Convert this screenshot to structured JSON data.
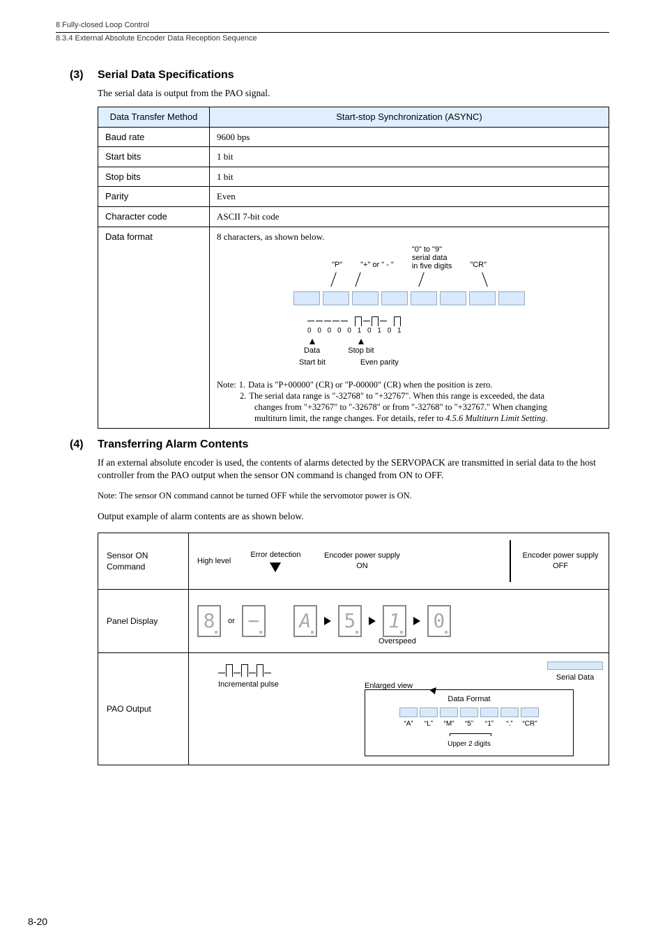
{
  "page": {
    "chapter_line": "8  Fully-closed Loop Control",
    "section_line": "8.3.4  External Absolute Encoder Data Reception Sequence",
    "page_number": "8-20"
  },
  "sec3": {
    "num": "(3)",
    "title": "Serial Data Specifications",
    "intro": "The serial data is output from the PAO signal.",
    "header_left": "Data Transfer Method",
    "header_right": "Start-stop Synchronization (ASYNC)",
    "rows": {
      "baud_label": "Baud rate",
      "baud_value": "9600 bps",
      "start_label": "Start bits",
      "start_value": "1 bit",
      "stop_label": "Stop bits",
      "stop_value": "1 bit",
      "parity_label": "Parity",
      "parity_value": "Even",
      "char_label": "Character code",
      "char_value": "ASCII 7-bit code",
      "format_label": "Data format",
      "format_value": "8 characters, as shown below."
    },
    "diagram": {
      "p_label": "\"P\"",
      "sign_label": "\"+\" or \" - \"",
      "digits_label_1": "\"0\" to \"9\"",
      "digits_label_2": "serial data",
      "digits_label_3": "in five digits",
      "cr_label": "\"CR\"",
      "bits_string": "0 0 0 0 0  1 0 1 0  1",
      "start_bit": "Start bit",
      "data_lbl": "Data",
      "even_parity": "Even parity",
      "stop_bit": "Stop bit"
    },
    "note_head": "Note:",
    "note_1_num": "1.",
    "note_1": "Data is \"P+00000\" (CR) or \"P-00000\" (CR) when the position is zero.",
    "note_2_num": "2.",
    "note_2a": "The serial data range is \"-32768\" to \"+32767\". When this range is exceeded, the data",
    "note_2b": "changes from \"+32767\" to \"-32678\" or from \"-32768\" to \"+32767.\"  When changing",
    "note_2c": "multiturn limit, the range changes.  For details, refer to ",
    "note_2c_ref": "4.5.6 Multiturn Limit Setting",
    "note_2c_end": "."
  },
  "sec4": {
    "num": "(4)",
    "title": "Transferring Alarm Contents",
    "para": "If an external absolute encoder is used, the contents of alarms detected by the SERVOPACK are transmitted in serial data to the host controller from the PAO output when the sensor ON command is changed from ON to OFF.",
    "note_head": "Note:",
    "note_text": "The sensor ON command cannot be turned OFF while the servomotor power is ON.",
    "out_line": "Output example of alarm contents are as shown below.",
    "row_sensor": "Sensor ON Command",
    "row_panel": "Panel Display",
    "row_pao": "PAO Output",
    "high_level": "High level",
    "error_det": "Error detection",
    "enc_on": "Encoder power supply ON",
    "enc_off": "Encoder power supply OFF",
    "or_text": "or",
    "overspeed": "Overspeed",
    "inc_pulse": "Incremental pulse",
    "serial_data": "Serial Data",
    "enlarged_view": "Enlarged view",
    "data_format": "Data Format",
    "df_chars": [
      "“A”",
      "“L”",
      "“M”",
      "“5”",
      "“1”",
      "“.”",
      "“CR”"
    ],
    "upper2": "Upper 2 digits"
  }
}
